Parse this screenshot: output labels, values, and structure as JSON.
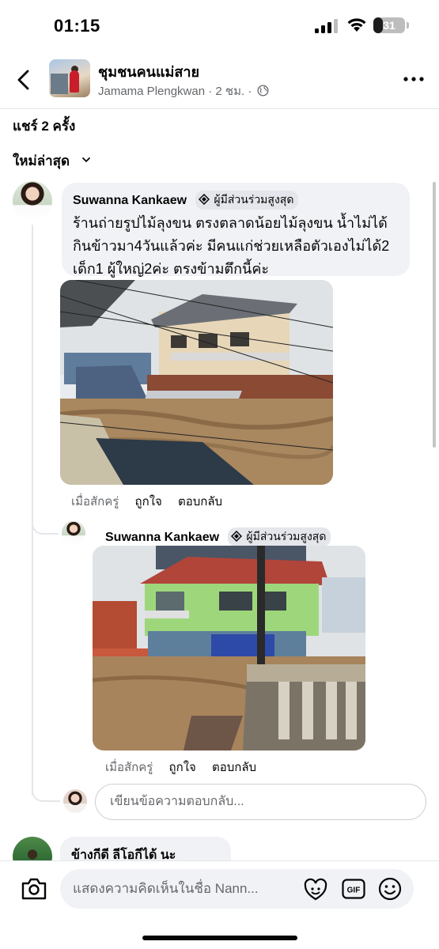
{
  "status_bar": {
    "time": "01:15",
    "battery_level": "31",
    "battery_fraction": 0.31,
    "icons": [
      "cellular-signal-icon",
      "wifi-icon",
      "battery-icon"
    ]
  },
  "header": {
    "group_name": "ชุมชนคนแม่สาย",
    "author": "Jamama Plengkwan",
    "time_ago": "2 ชม.",
    "separator": "·"
  },
  "shares_text": "แชร์ 2 ครั้ง",
  "sort_label": "ใหม่ล่าสุด",
  "comments": [
    {
      "author": "Suwanna Kankaew",
      "badge": "ผู้มีส่วนร่วมสูงสุด",
      "lines": [
        "ร้านถ่ายรูปไม้ลุงขน  ตรงตลาดน้อยไม้ลุงขน น้ำไม่ได้",
        "กินข้าวมา4วันแล้วค่ะ มีคนแก่ช่วยเหลือตัวเองไม่ได้2",
        "เด็ก1 ผู้ใหญ่2ค่ะ ตรงข้ามตึกนี้ค่ะ"
      ],
      "time": "เมื่อสักครู่",
      "like": "ถูกใจ",
      "reply": "ตอบกลับ"
    },
    {
      "author": "Suwanna Kankaew",
      "badge": "ผู้มีส่วนร่วมสูงสุด",
      "time": "เมื่อสักครู่",
      "like": "ถูกใจ",
      "reply": "ตอบกลับ"
    },
    {
      "author": "ข้างกีดี ลีโอกีได้ นะ"
    }
  ],
  "reply_placeholder": "เขียนข้อความตอบกลับ...",
  "comment_placeholder": "แสดงความคิดเห็นในชื่อ Nann...",
  "colors": {
    "text": "#050505",
    "secondary": "#65676b",
    "bubble": "#f0f2f5",
    "divider": "#e4e6eb"
  }
}
